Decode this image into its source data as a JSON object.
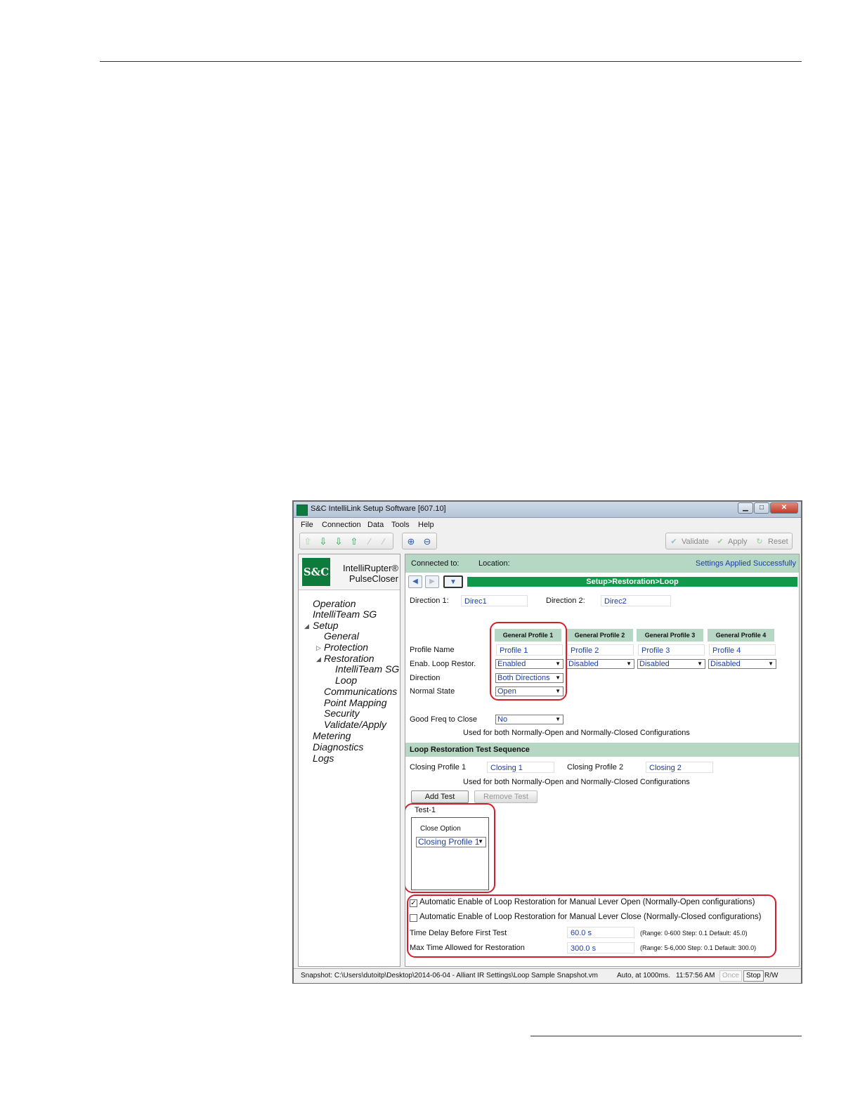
{
  "window": {
    "title": "S&C IntelliLink Setup Software [607.10]",
    "controls": {
      "minimize": "▁",
      "maximize": "□",
      "close": "✕"
    }
  },
  "menu": [
    "File",
    "Connection",
    "Data",
    "Tools",
    "Help"
  ],
  "toolbar": {
    "validate_label": "Validate",
    "apply_label": "Apply",
    "reset_label": "Reset"
  },
  "sidebar": {
    "logo_text": "S&C",
    "product_line1": "IntelliRupter®",
    "product_line2": "PulseCloser",
    "tree": {
      "operation": "Operation",
      "intelliteam": "IntelliTeam SG",
      "setup": "Setup",
      "general": "General",
      "protection": "Protection",
      "restoration": "Restoration",
      "restoration_intelliteam": "IntelliTeam SG",
      "loop": "Loop",
      "communications": "Communications",
      "point_mapping": "Point Mapping",
      "security": "Security",
      "validate_apply": "Validate/Apply",
      "metering": "Metering",
      "diagnostics": "Diagnostics",
      "logs": "Logs"
    }
  },
  "header": {
    "connected_label": "Connected to:",
    "location_label": "Location:",
    "status": "Settings Applied Successfully",
    "breadcrumb": "Setup>Restoration>Loop"
  },
  "directions": {
    "d1_label": "Direction 1:",
    "d1_value": "Direc1",
    "d2_label": "Direction 2:",
    "d2_value": "Direc2"
  },
  "profiles": {
    "headers": [
      "General Profile 1",
      "General Profile 2",
      "General Profile 3",
      "General Profile 4"
    ],
    "row_labels": {
      "name": "Profile Name",
      "enab": "Enab. Loop Restor.",
      "direction": "Direction",
      "normal_state": "Normal State"
    },
    "names": [
      "Profile 1",
      "Profile 2",
      "Profile 3",
      "Profile 4"
    ],
    "enab": [
      "Enabled",
      "Disabled",
      "Disabled",
      "Disabled"
    ],
    "direction": "Both Directions",
    "normal_state": "Open"
  },
  "good_freq": {
    "label": "Good Freq to Close",
    "value": "No",
    "note": "Used for both Normally-Open and Normally-Closed Configurations"
  },
  "test_sequence": {
    "section_title": "Loop Restoration Test Sequence",
    "closing1_label": "Closing Profile 1",
    "closing1_value": "Closing 1",
    "closing2_label": "Closing Profile 2",
    "closing2_value": "Closing 2",
    "note": "Used for both Normally-Open and Normally-Closed Configurations",
    "add_test": "Add Test",
    "remove_test": "Remove Test",
    "test_title": "Test-1",
    "close_option_label": "Close Option",
    "close_option_value": "Closing Profile 1"
  },
  "auto": {
    "open_label": "Automatic Enable of Loop Restoration for Manual Lever Open (Normally-Open configurations)",
    "open_checked": true,
    "close_label": "Automatic Enable of Loop Restoration for Manual Lever Close (Normally-Closed configurations)",
    "close_checked": false,
    "delay_label": "Time Delay Before First Test",
    "delay_value": "60.0 s",
    "delay_range": "(Range: 0-600 Step: 0.1 Default: 45.0)",
    "max_label": "Max Time Allowed for Restoration",
    "max_value": "300.0 s",
    "max_range": "(Range: 5-6,000 Step: 0.1 Default: 300.0)"
  },
  "statusbar": {
    "snapshot": "Snapshot: C:\\Users\\dutoitp\\Desktop\\2014-06-04 - Alliant IR Settings\\Loop Sample Snapshot.vm",
    "mode": "Auto, at 1000ms.",
    "time": "11:57:56 AM",
    "once": "Once",
    "stop": "Stop",
    "rw": "R/W"
  },
  "colors": {
    "accent_green": "#0e9a4a",
    "header_green": "#b6d7c4",
    "value_blue": "#1b3ea8",
    "highlight_red": "#d21f2b"
  }
}
